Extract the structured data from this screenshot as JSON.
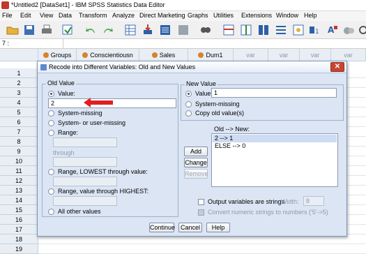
{
  "window": {
    "title": "*Untitled2 [DataSet1] - IBM SPSS Statistics Data Editor"
  },
  "menu": [
    "File",
    "Edit",
    "View",
    "Data",
    "Transform",
    "Analyze",
    "Direct Marketing",
    "Graphs",
    "Utilities",
    "Extensions",
    "Window",
    "Help"
  ],
  "cellref": {
    "text": "7 :"
  },
  "grid": {
    "columns": [
      "Groups",
      "Conscientiousn",
      "Sales",
      "Dum1",
      "var",
      "var",
      "var",
      "var"
    ],
    "rows": [
      "1",
      "2",
      "3",
      "4",
      "5",
      "6",
      "7",
      "8",
      "9",
      "10",
      "11",
      "12",
      "13",
      "14",
      "15",
      "16",
      "17",
      "18",
      "19"
    ]
  },
  "dialog": {
    "title": "Recode into Different Variables: Old and New Values",
    "old_value": {
      "group_title": "Old Value",
      "value_label": "Value:",
      "value_input": "2",
      "system_missing": "System-missing",
      "system_or_user_missing": "System- or user-missing",
      "range": "Range:",
      "through": "through",
      "range_lowest": "Range, LOWEST through value:",
      "range_highest": "Range, value through HIGHEST:",
      "all_other": "All other values"
    },
    "new_value": {
      "group_title": "New Value",
      "value_label": "Value:",
      "value_input": "1",
      "system_missing": "System-missing",
      "copy_old": "Copy old value(s)"
    },
    "old_new": {
      "label": "Old --> New:",
      "items": [
        "2 --> 1",
        "ELSE --> 0"
      ]
    },
    "buttons": {
      "add": "Add",
      "change": "Change",
      "remove": "Remove",
      "continue": "Continue",
      "cancel": "Cancel",
      "help": "Help"
    },
    "options": {
      "output_strings": "Output variables are strings",
      "width_label": "Width:",
      "width_value": "8",
      "convert_numeric": "Convert numeric strings to numbers ('5'->5)"
    }
  },
  "colors": {
    "accent": "#2a4d86",
    "arrow": "#e02020",
    "dialog_bg": "#dbe5f3"
  }
}
